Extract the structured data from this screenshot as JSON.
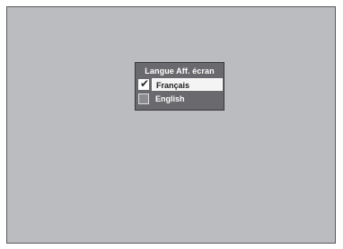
{
  "menu": {
    "title": "Langue Aff. écran",
    "options": [
      {
        "label": "Français",
        "checked": true,
        "selected": true
      },
      {
        "label": "English",
        "checked": false,
        "selected": false
      }
    ]
  },
  "icons": {
    "checked": "checkmark-icon"
  },
  "colors": {
    "screen_bg": "#bbbcc0",
    "menu_bg": "#6a6a6e",
    "selected_bg": "#f4f4f4",
    "text_light": "#ffffff"
  }
}
